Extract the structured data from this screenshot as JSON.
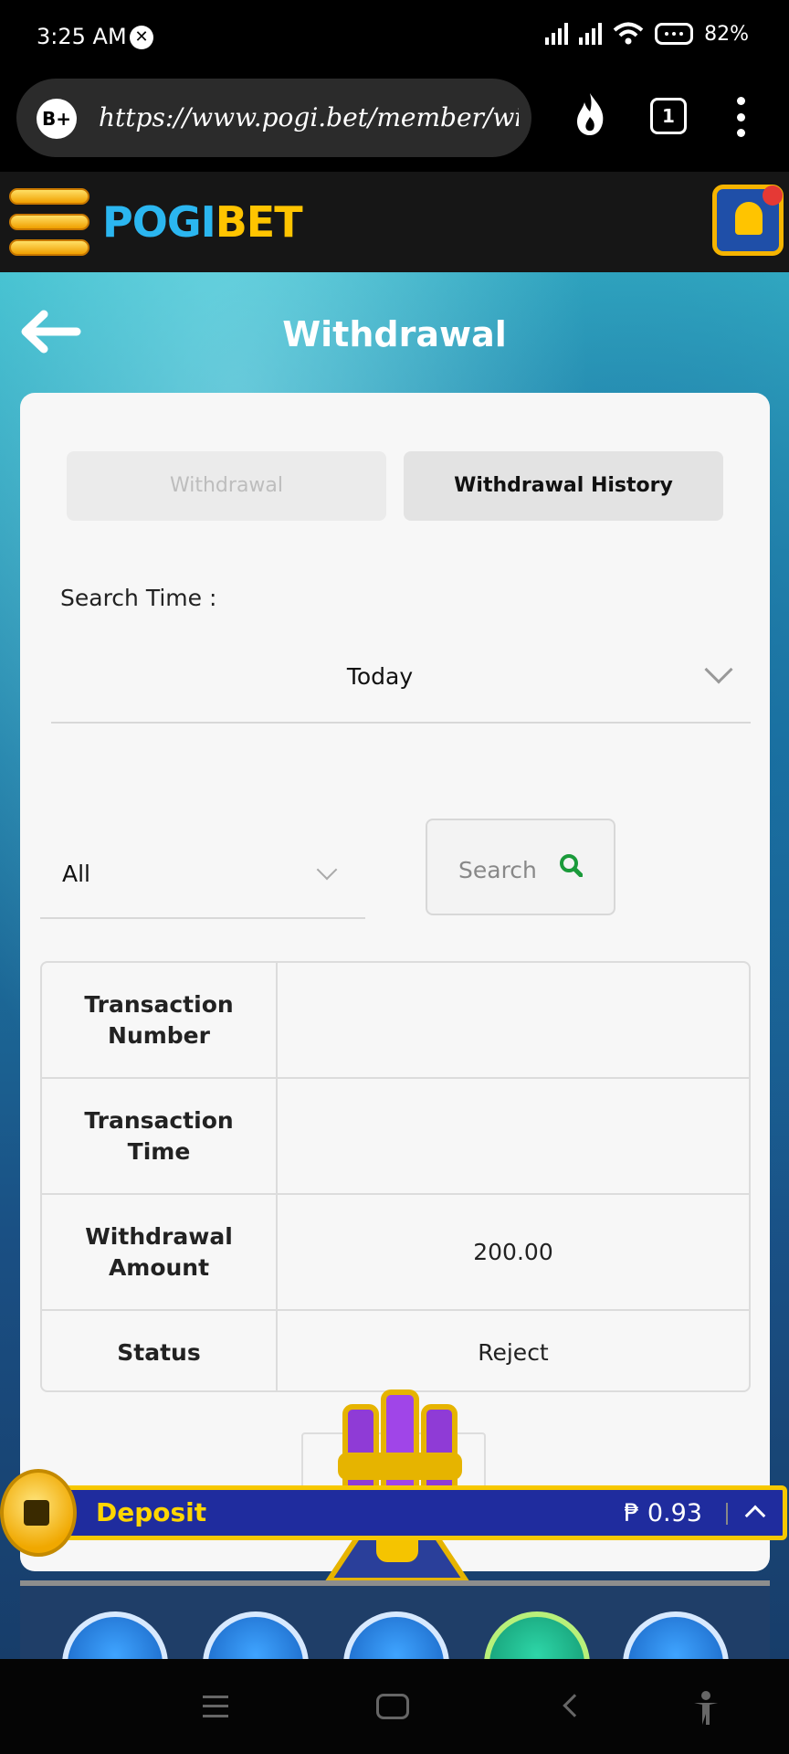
{
  "status_bar": {
    "time": "3:25 AM",
    "battery": "82%"
  },
  "browser": {
    "badge": "B+",
    "url": "https://www.pogi.bet/member/withd",
    "tab_count": "1"
  },
  "site": {
    "logo_part1": "POGI",
    "logo_part2": "BET"
  },
  "page": {
    "title": "Withdrawal"
  },
  "tabs": {
    "withdrawal": "Withdrawal",
    "history": "Withdrawal History"
  },
  "filters": {
    "search_time_label": "Search Time :",
    "time_value": "Today",
    "status_value": "All",
    "search_button": "Search"
  },
  "table": {
    "rows": [
      {
        "label": "Transaction Number",
        "value": ""
      },
      {
        "label": "Transaction Time",
        "value": ""
      },
      {
        "label": "Withdrawal Amount",
        "value": "200.00"
      },
      {
        "label": "Status",
        "value": "Reject"
      }
    ]
  },
  "deposit_bar": {
    "label": "Deposit",
    "balance": "₱ 0.93"
  },
  "colors": {
    "brand_blue": "#2bb6f0",
    "brand_gold": "#ffc400",
    "search_icon": "#1a9a3a",
    "deposit_bg": "#1f2c9e"
  },
  "icons": [
    "sync-icon",
    "signal-icon",
    "wifi-icon",
    "battery-icon",
    "fire-icon",
    "kebab-menu-icon",
    "hamburger-menu-icon",
    "bell-icon",
    "back-arrow-icon",
    "chevron-down-icon",
    "search-icon",
    "coin-icon",
    "chevron-up-icon",
    "home-icon",
    "gamepad-icon",
    "gift-icon",
    "community-icon",
    "support-icon"
  ]
}
